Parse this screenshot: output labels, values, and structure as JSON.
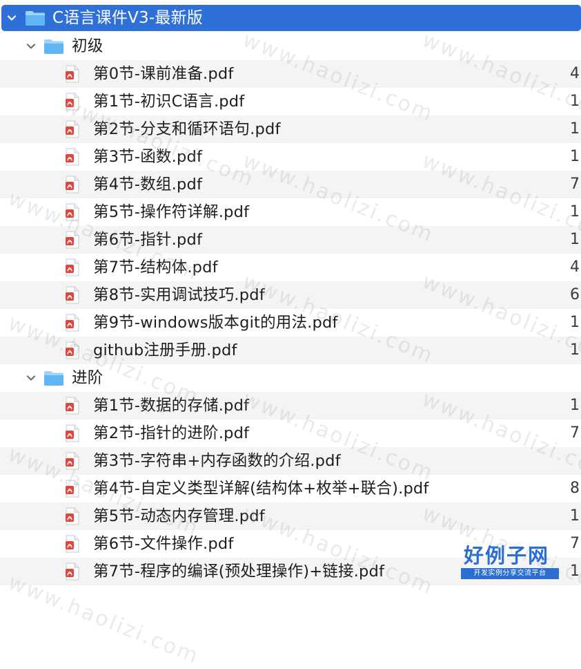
{
  "root": {
    "label": "C语言课件V3-最新版"
  },
  "groups": [
    {
      "label": "初级",
      "files": [
        {
          "name": "第0节-课前准备.pdf",
          "size": "4"
        },
        {
          "name": "第1节-初识C语言.pdf",
          "size": "1"
        },
        {
          "name": "第2节-分支和循环语句.pdf",
          "size": "1"
        },
        {
          "name": "第3节-函数.pdf",
          "size": "1"
        },
        {
          "name": "第4节-数组.pdf",
          "size": "7"
        },
        {
          "name": "第5节-操作符详解.pdf",
          "size": "1"
        },
        {
          "name": "第6节-指针.pdf",
          "size": "1"
        },
        {
          "name": "第7节-结构体.pdf",
          "size": "4"
        },
        {
          "name": "第8节-实用调试技巧.pdf",
          "size": "6"
        },
        {
          "name": "第9节-windows版本git的用法.pdf",
          "size": "1"
        },
        {
          "name": "github注册手册.pdf",
          "size": "1"
        }
      ]
    },
    {
      "label": "进阶",
      "files": [
        {
          "name": "第1节-数据的存储.pdf",
          "size": "1"
        },
        {
          "name": "第2节-指针的进阶.pdf",
          "size": "7"
        },
        {
          "name": "第3节-字符串+内存函数的介绍.pdf",
          "size": ""
        },
        {
          "name": "第4节-自定义类型详解(结构体+枚举+联合).pdf",
          "size": "8"
        },
        {
          "name": "第5节-动态内存管理.pdf",
          "size": "1"
        },
        {
          "name": "第6节-文件操作.pdf",
          "size": "7"
        },
        {
          "name": "第7节-程序的编译(预处理操作)+链接.pdf",
          "size": "1"
        }
      ]
    }
  ],
  "watermark": {
    "text": "www.haolizi.com"
  },
  "logo": {
    "main": "好例子网",
    "sub": "开发实例分享交流平台"
  },
  "colors": {
    "selection": "#2f6fd8",
    "folder": "#4aa8ee",
    "pdf_badge": "#e5423a",
    "stripe": "#f4f4f5"
  },
  "icons": {
    "disclosure": "chevron-down-icon",
    "folder": "folder-icon",
    "file": "pdf-file-icon"
  }
}
